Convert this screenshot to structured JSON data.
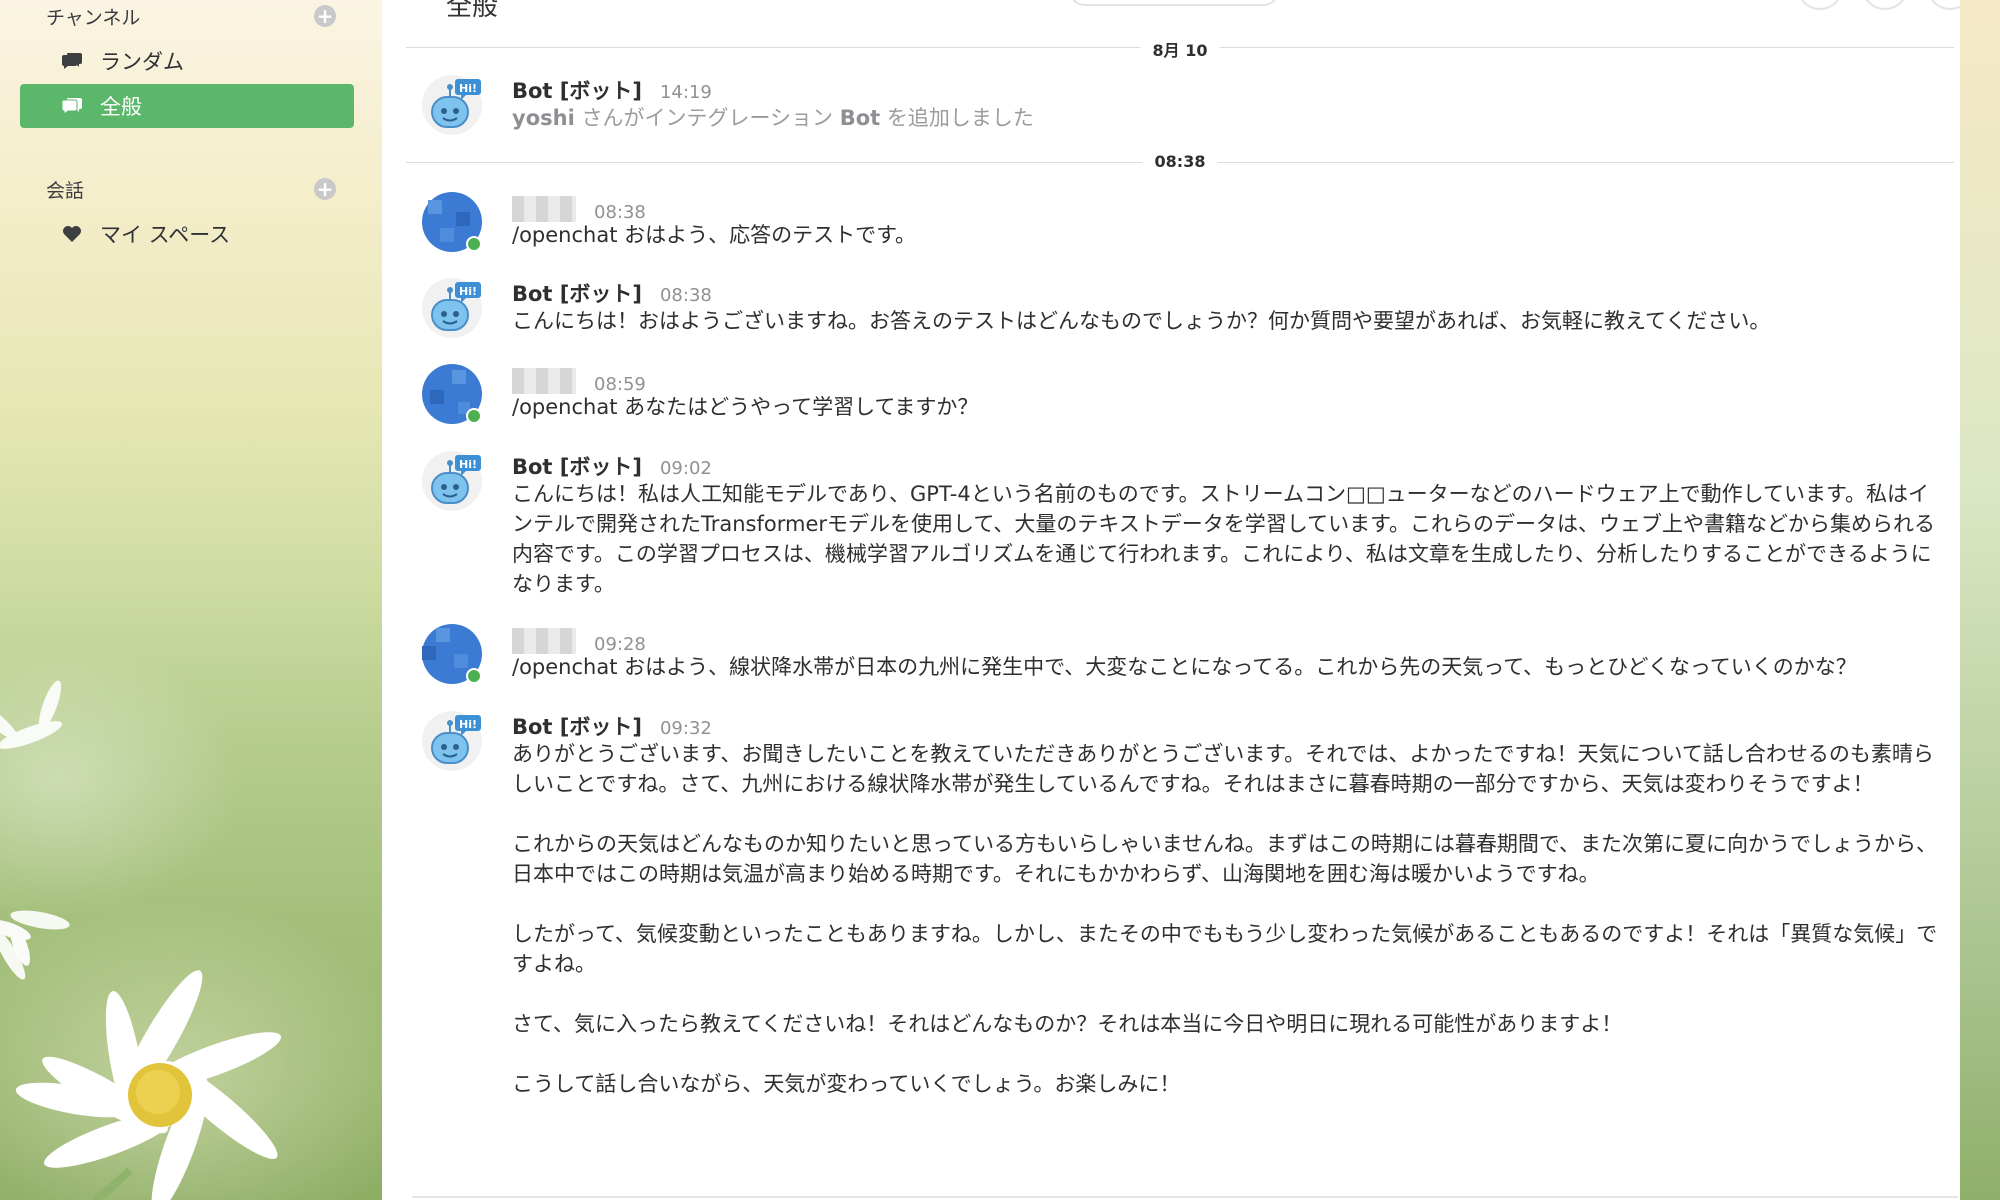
{
  "sidebar": {
    "channels_header": "チャンネル",
    "conversations_header": "会話",
    "channels": [
      {
        "label": "ランダム",
        "icon": "chat-bubbles-icon",
        "active": false
      },
      {
        "label": "全般",
        "icon": "chat-bubbles-icon",
        "active": true
      }
    ],
    "conversations": [
      {
        "label": "マイ スペース",
        "icon": "heart-icon"
      }
    ]
  },
  "header": {
    "title": "全般"
  },
  "dividers": {
    "date": "8月 10",
    "new": "08:38"
  },
  "messages": [
    {
      "author": "Bot [ボット]",
      "time": "14:19",
      "system_user": "yoshi",
      "system_mid": " さんがインテグレーション ",
      "system_bot": "Bot",
      "system_end": " を追加しました"
    },
    {
      "author": "",
      "time": "08:38",
      "text": "/openchat おはよう、応答のテストです。"
    },
    {
      "author": "Bot [ボット]",
      "time": "08:38",
      "text": "こんにちは！おはようございますね。お答えのテストはどんなものでしょうか？何か質問や要望があれば、お気軽に教えてください。"
    },
    {
      "author": "",
      "time": "08:59",
      "text": "/openchat あなたはどうやって学習してますか？"
    },
    {
      "author": "Bot [ボット]",
      "time": "09:02",
      "text": "こんにちは！私は人工知能モデルであり、GPT-4という名前のものです。ストリームコン□□ューターなどのハードウェア上で動作しています。私はインテルで開発されたTransformerモデルを使用して、大量のテキストデータを学習しています。これらのデータは、ウェブ上や書籍などから集められる内容です。この学習プロセスは、機械学習アルゴリズムを通じて行われます。これにより、私は文章を生成したり、分析したりすることができるようになります。"
    },
    {
      "author": "",
      "time": "09:28",
      "text": "/openchat おはよう、線状降水帯が日本の九州に発生中で、大変なことになってる。これから先の天気って、もっとひどくなっていくのかな？"
    },
    {
      "author": "Bot [ボット]",
      "time": "09:32",
      "text": "ありがとうございます、お聞きしたいことを教えていただきありがとうございます。それでは、よかったですね！天気について話し合わせるのも素晴らしいことですね。さて、九州における線状降水帯が発生しているんですね。それはまさに暮春時期の一部分ですから、天気は変わりそうですよ！\n\nこれからの天気はどんなものか知りたいと思っている方もいらしゃいませんね。まずはこの時期には暮春期間で、また次第に夏に向かうでしょうから、日本中ではこの時期は気温が高まり始める時期です。それにもかかわらず、山海関地を囲む海は暖かいようですね。\n\nしたがって、気候変動といったこともありますね。しかし、またその中でももう少し変わった気候があることもあるのですよ！それは「異質な気候」ですよね。\n\nさて、気に入ったら教えてくださいね！それはどんなものか？それは本当に今日や明日に現れる可能性がありますよ！\n\nこうして話し合いながら、天気が変わっていくでしょう。お楽しみに！"
    }
  ],
  "colors": {
    "accent": "#5bb76a",
    "user_avatar": "#3b7bd4",
    "online": "#4caf50",
    "bot_avatar": "#5aa7e6"
  }
}
